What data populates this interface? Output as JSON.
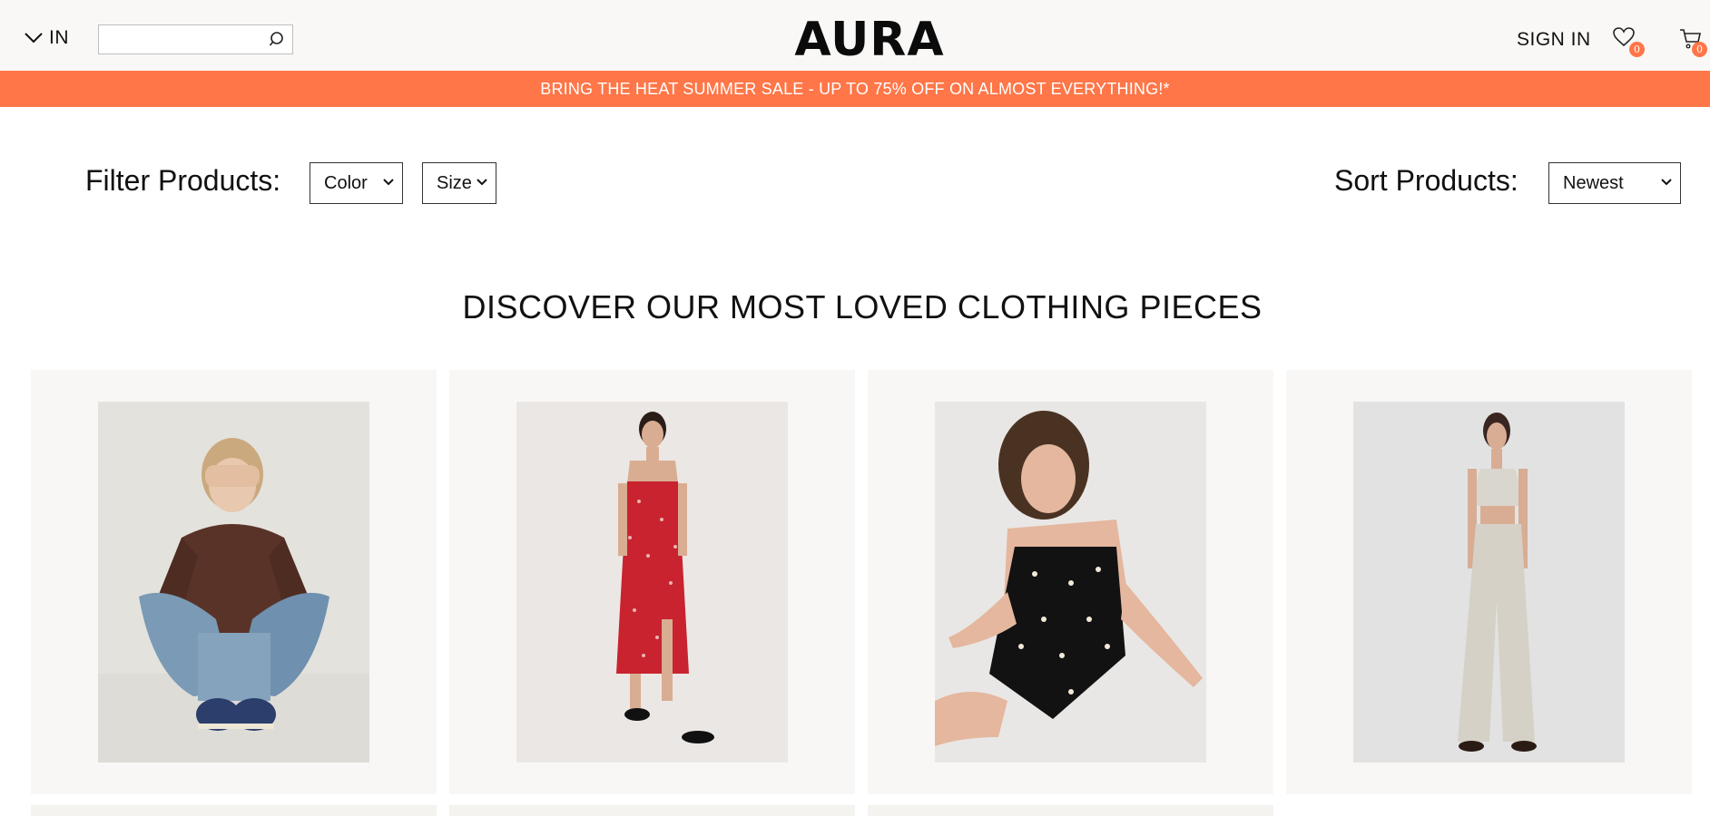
{
  "header": {
    "locale": "IN",
    "search_placeholder": "",
    "brand": "AURA",
    "sign_in": "SIGN IN",
    "wishlist_count": "0",
    "cart_count": "0"
  },
  "promo": {
    "text": "BRING THE HEAT SUMMER SALE - UP TO 75% OFF ON ALMOST EVERYTHING!*"
  },
  "filters": {
    "label": "Filter Products:",
    "color_select": "Color",
    "size_select": "Size",
    "sort_label": "Sort Products:",
    "sort_select": "Newest"
  },
  "main": {
    "section_title": "DISCOVER OUR MOST LOVED CLOTHING PIECES",
    "products": [
      {
        "image": "woman-brown-sweater-jeans-sneakers"
      },
      {
        "image": "woman-red-floral-slip-dress"
      },
      {
        "image": "woman-black-heart-print-mini-dress"
      },
      {
        "image": "woman-linen-crop-top-wide-pants"
      }
    ]
  },
  "colors": {
    "accent": "#ff7648",
    "header_bg": "#f9f8f6",
    "card_bg": "#f9f7f5"
  }
}
